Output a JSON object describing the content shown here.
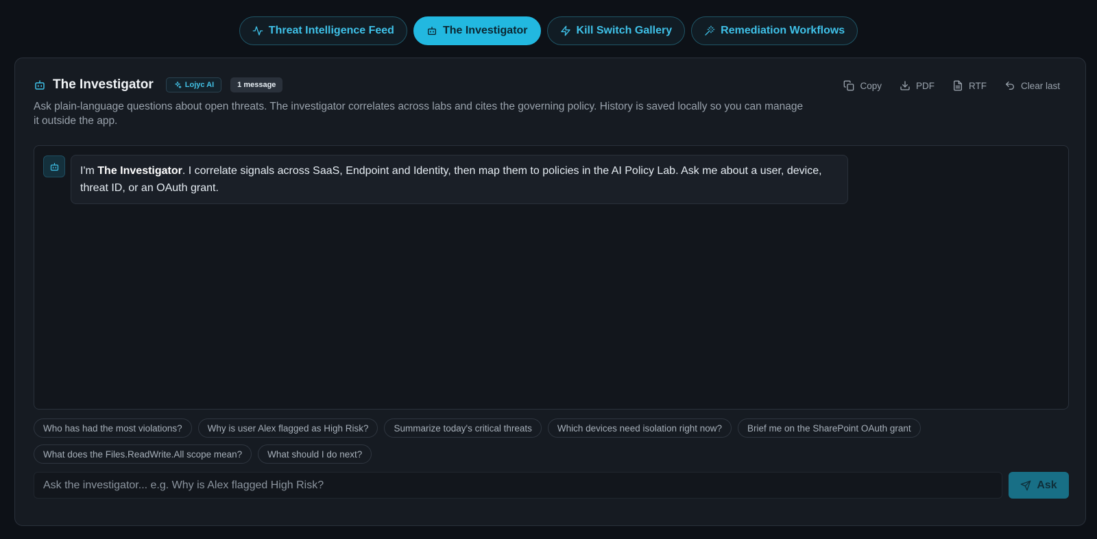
{
  "tabs": [
    {
      "label": "Threat Intelligence Feed",
      "icon": "activity-icon",
      "active": false
    },
    {
      "label": "The Investigator",
      "icon": "bot-icon",
      "active": true
    },
    {
      "label": "Kill Switch Gallery",
      "icon": "zap-icon",
      "active": false
    },
    {
      "label": "Remediation Workflows",
      "icon": "wand-icon",
      "active": false
    }
  ],
  "panel": {
    "title": "The Investigator",
    "ai_badge": "Lojyc AI",
    "message_count": "1 message",
    "description": "Ask plain-language questions about open threats. The investigator correlates across labs and cites the governing policy. History is saved locally so you can manage it outside the app.",
    "actions": {
      "copy": "Copy",
      "pdf": "PDF",
      "rtf": "RTF",
      "clear": "Clear last"
    }
  },
  "chat": {
    "messages": [
      {
        "role": "assistant",
        "prefix": "I'm ",
        "bold": "The Investigator",
        "text": ". I correlate signals across SaaS, Endpoint and Identity, then map them to policies in the AI Policy Lab. Ask me about a user, device, threat ID, or an OAuth grant."
      }
    ]
  },
  "suggestions": [
    "Who has had the most violations?",
    "Why is user Alex flagged as High Risk?",
    "Summarize today's critical threats",
    "Which devices need isolation right now?",
    "Brief me on the SharePoint OAuth grant",
    "What does the Files.ReadWrite.All scope mean?",
    "What should I do next?"
  ],
  "input": {
    "placeholder": "Ask the investigator... e.g. Why is Alex flagged High Risk?",
    "value": ""
  },
  "ask_button": "Ask",
  "colors": {
    "accent": "#22b8e0",
    "background": "#0d1117",
    "panel": "#161b22"
  }
}
